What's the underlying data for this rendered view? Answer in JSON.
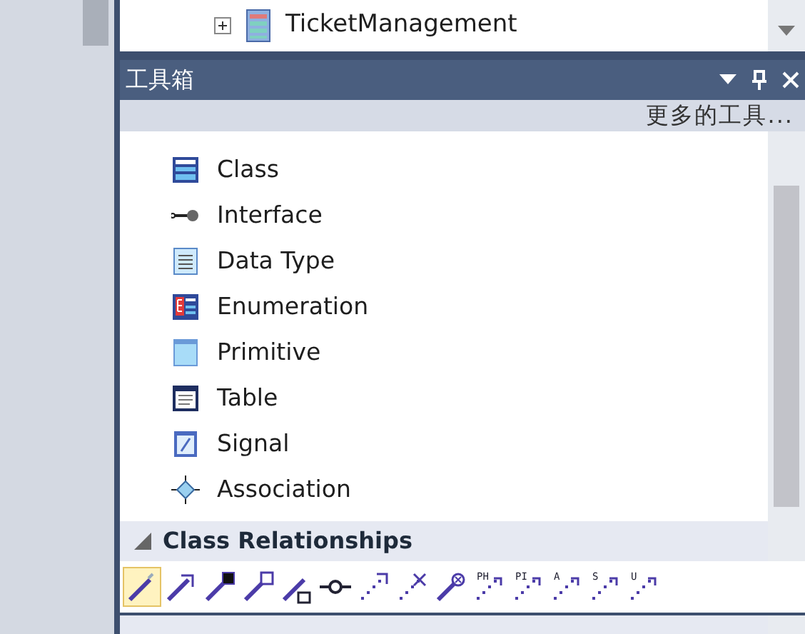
{
  "top_tree": {
    "items": [
      {
        "label": "TicketManagement",
        "expanded": false
      }
    ]
  },
  "toolbox": {
    "title": "工具箱",
    "more_tools": "更多的工具...",
    "items": [
      {
        "label": "Class",
        "kind": "class"
      },
      {
        "label": "Interface",
        "kind": "interface"
      },
      {
        "label": "Data Type",
        "kind": "datatype"
      },
      {
        "label": "Enumeration",
        "kind": "enumeration"
      },
      {
        "label": "Primitive",
        "kind": "primitive"
      },
      {
        "label": "Table",
        "kind": "table"
      },
      {
        "label": "Signal",
        "kind": "signal"
      },
      {
        "label": "Association",
        "kind": "association"
      }
    ],
    "section": {
      "title": "Class Relationships",
      "expanded": true
    },
    "tools": [
      {
        "kind": "line",
        "selected": true
      },
      {
        "kind": "arrow",
        "selected": false
      },
      {
        "kind": "filled-square",
        "selected": false
      },
      {
        "kind": "hollow-square",
        "selected": false
      },
      {
        "kind": "line-box",
        "selected": false
      },
      {
        "kind": "lollipop",
        "selected": false
      },
      {
        "kind": "dotted-arrow",
        "selected": false
      },
      {
        "kind": "dotted-cross",
        "selected": false
      },
      {
        "kind": "circle-cross",
        "selected": false
      },
      {
        "kind": "lettered",
        "label": "PH",
        "selected": false
      },
      {
        "kind": "lettered",
        "label": "PI",
        "selected": false
      },
      {
        "kind": "lettered",
        "label": "A",
        "selected": false
      },
      {
        "kind": "lettered",
        "label": "S",
        "selected": false
      },
      {
        "kind": "lettered",
        "label": "U",
        "selected": false
      }
    ]
  }
}
